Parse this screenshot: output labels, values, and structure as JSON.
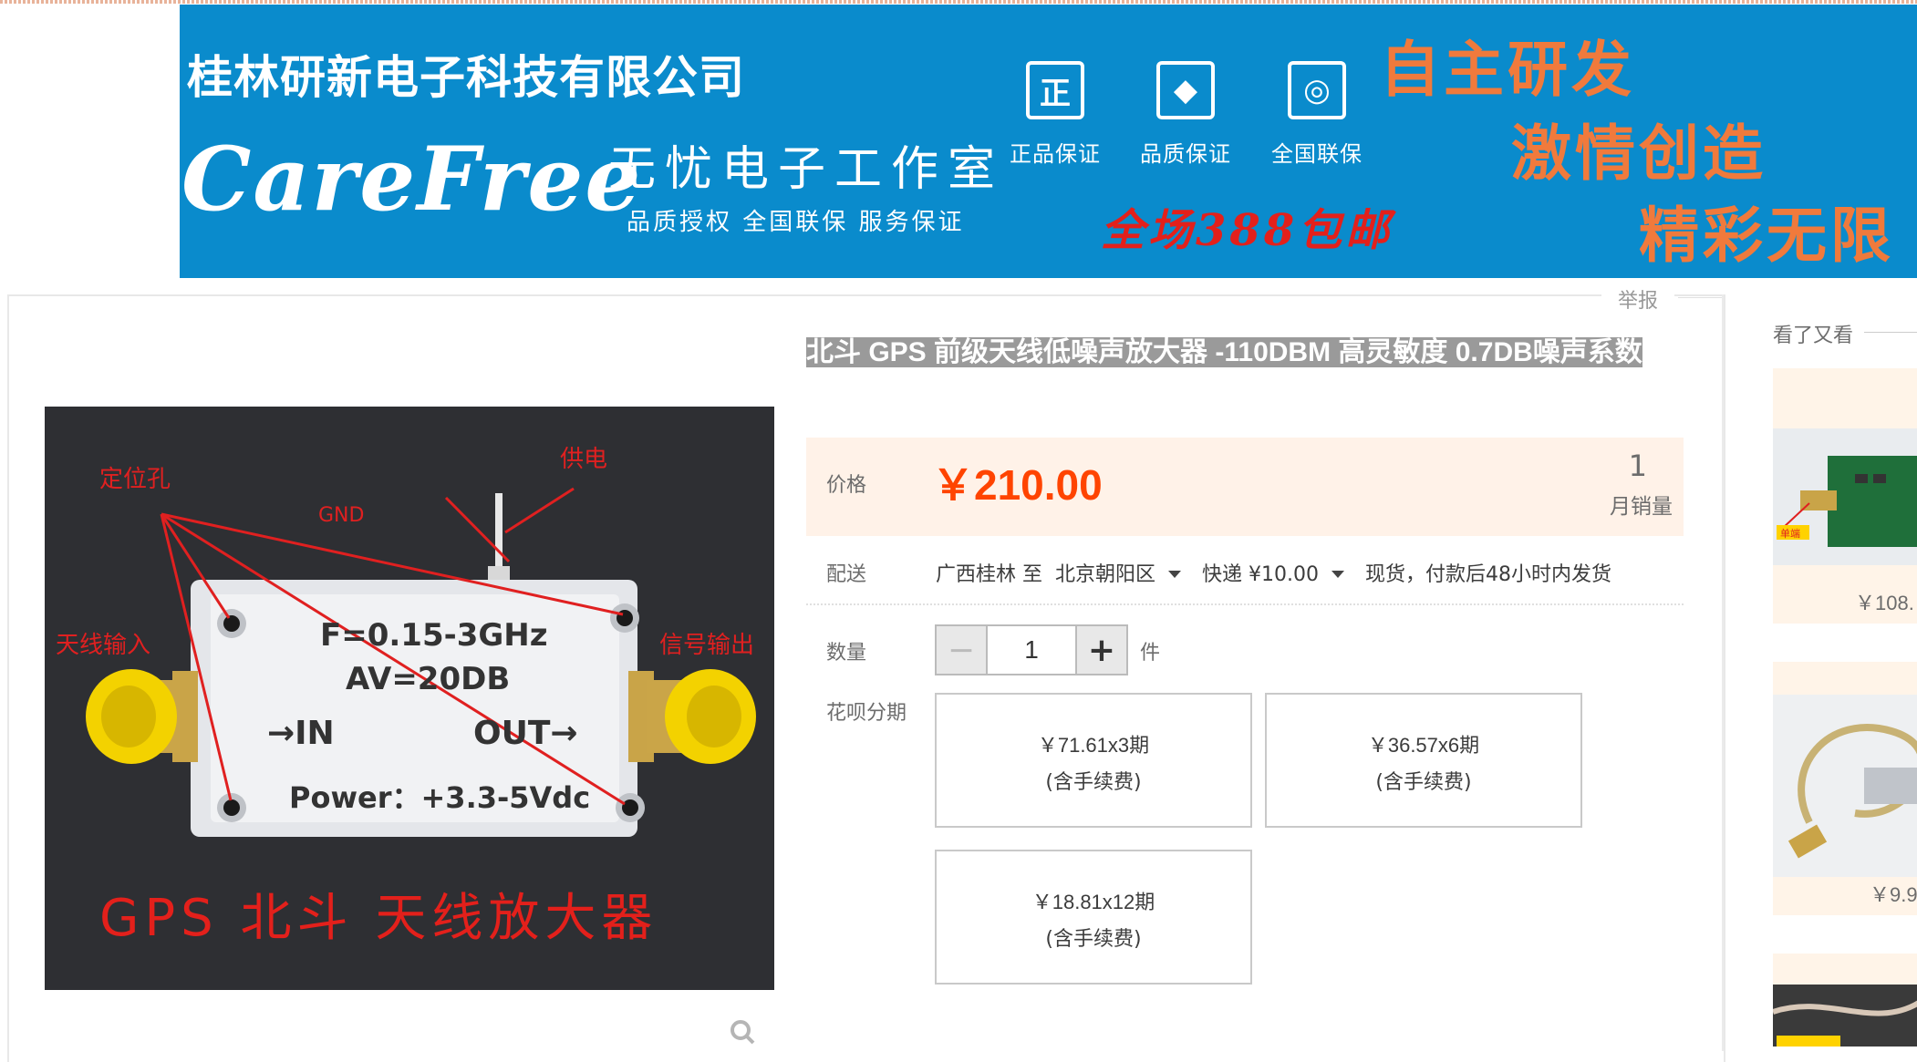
{
  "banner": {
    "company": "桂林研新电子科技有限公司",
    "logo": "CareFree",
    "studio": "无忧电子工作室",
    "studio_sub": "品质授权 全国联保 服务保证",
    "badges": [
      {
        "icon": "正",
        "label": "正品保证"
      },
      {
        "icon": "◆",
        "label": "品质保证"
      },
      {
        "icon": "◎",
        "label": "全国联保"
      }
    ],
    "promo": "全场388包邮",
    "slogans": [
      "自主研发",
      "激情创造",
      "精彩无限"
    ]
  },
  "report": "举报",
  "product": {
    "title": "北斗 GPS 前级天线低噪声放大器 -110DBM 高灵敏度 0.7DB噪声系数",
    "image_text": {
      "freq": "F=0.15-3GHz",
      "gain": "AV=20DB",
      "in": "→IN",
      "out": "OUT→",
      "power": "Power：+3.3-5Vdc",
      "caption": "GPS 北斗 天线放大器",
      "anno_holes": "定位孔",
      "anno_power": "供电",
      "anno_gnd": "GND",
      "anno_in": "天线输入",
      "anno_out": "信号输出"
    }
  },
  "price": {
    "label": "价格",
    "value": "￥210.00",
    "sales_count": "1",
    "sales_label": "月销量"
  },
  "delivery": {
    "label": "配送",
    "from": "广西桂林 至",
    "to": "北京朝阳区",
    "express": "快递 ¥10.00",
    "note": "现货，付款后48小时内发货"
  },
  "quantity": {
    "label": "数量",
    "value": "1",
    "unit": "件",
    "minus": "−",
    "plus": "+"
  },
  "installments": {
    "label": "花呗分期",
    "options": [
      {
        "amount": "￥71.61x3期",
        "fee": "(含手续费)"
      },
      {
        "amount": "￥36.57x6期",
        "fee": "(含手续费)"
      },
      {
        "amount": "￥18.81x12期",
        "fee": "(含手续费)"
      }
    ]
  },
  "recommend": {
    "title": "看了又看",
    "items": [
      {
        "price": "￥108.",
        "tag": "单端"
      },
      {
        "price": "￥9.9"
      },
      {
        "price": ""
      }
    ]
  },
  "colors": {
    "banner_bg": "#0a8bcc",
    "price": "#ff4400",
    "price_bg": "#fff2e8",
    "slogan": "#f07a3c"
  }
}
